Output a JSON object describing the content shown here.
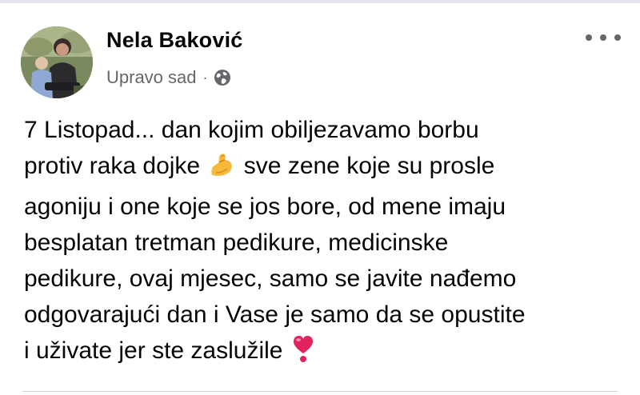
{
  "post": {
    "author_name": "Nela Baković",
    "timestamp": "Upravo sad",
    "separator": "·",
    "audience_icon": "globe-icon",
    "more_icon": "more-options-icon",
    "body_lines": [
      {
        "before": "7 Listopad... dan kojim obiljezavamo borbu"
      },
      {
        "before": "protiv raka dojke",
        "emoji": "flexed-biceps-icon",
        "after": "sve zene koje su prosle"
      },
      {
        "before": "agoniju i one koje se jos bore, od mene imaju"
      },
      {
        "before": "besplatan tretman pedikure, medicinske"
      },
      {
        "before": "pedikure, ovaj mjesec, samo se javite nađemo"
      },
      {
        "before": "odgovarajući dan i Vase je samo da se opustite"
      },
      {
        "before": "i uživate jer ste zaslužile",
        "emoji": "heavy-heart-exclamation-icon"
      }
    ]
  },
  "colors": {
    "name_text": "#050505",
    "secondary_text": "#65676b",
    "emoji_muscle": "#f6b93b",
    "emoji_heart": "#e0245e"
  }
}
